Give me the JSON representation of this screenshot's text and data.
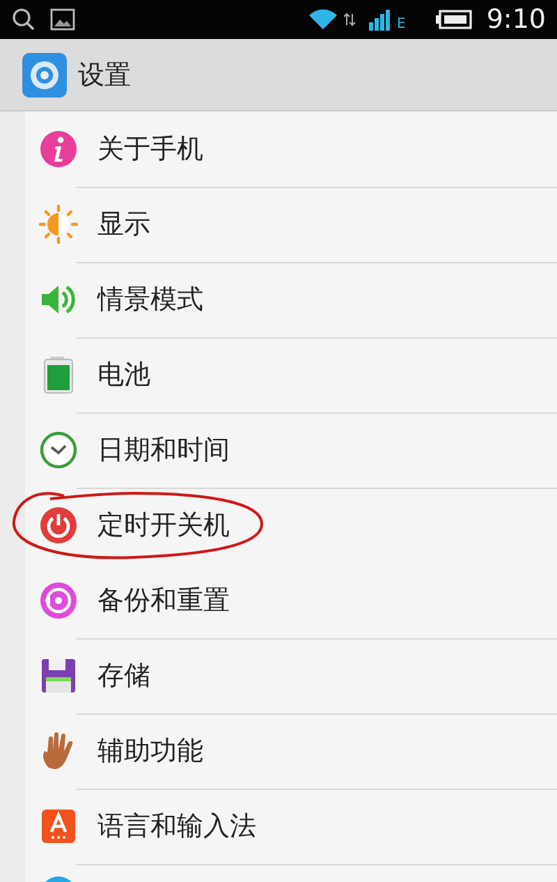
{
  "status_bar": {
    "network_type": "E",
    "time": "9:10"
  },
  "app_bar": {
    "title": "设置"
  },
  "items": [
    {
      "kind": "info",
      "label": "关于手机",
      "circled": false
    },
    {
      "kind": "display",
      "label": "显示",
      "circled": false
    },
    {
      "kind": "sound",
      "label": "情景模式",
      "circled": false
    },
    {
      "kind": "battery",
      "label": "电池",
      "circled": false
    },
    {
      "kind": "clock",
      "label": "日期和时间",
      "circled": false
    },
    {
      "kind": "power",
      "label": "定时开关机",
      "circled": true
    },
    {
      "kind": "backup",
      "label": "备份和重置",
      "circled": false
    },
    {
      "kind": "storage",
      "label": "存储",
      "circled": false
    },
    {
      "kind": "hand",
      "label": "辅助功能",
      "circled": false
    },
    {
      "kind": "language",
      "label": "语言和输入法",
      "circled": false
    },
    {
      "kind": "globe",
      "circled": false
    }
  ]
}
